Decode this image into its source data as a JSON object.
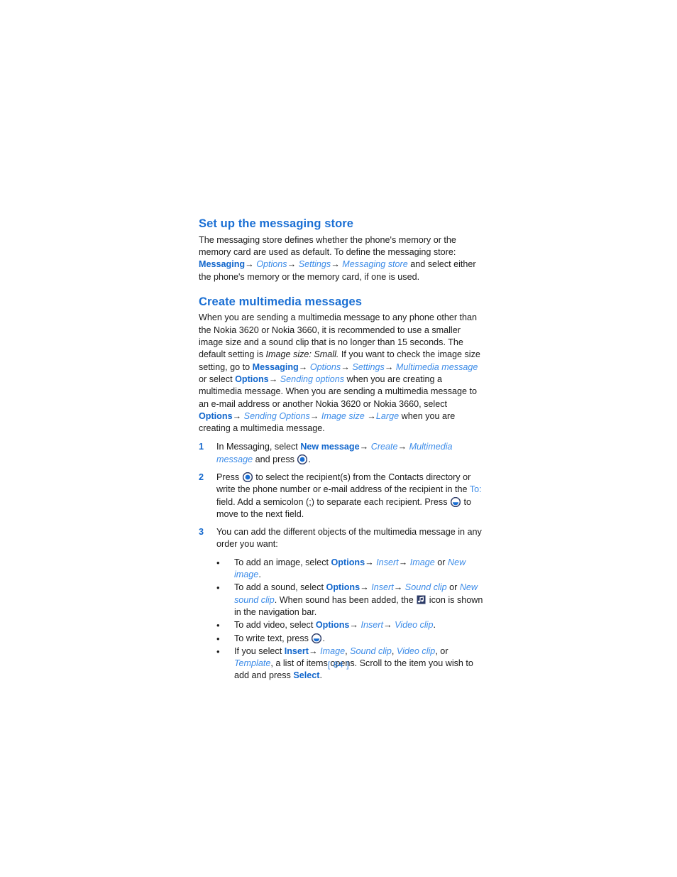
{
  "colors": {
    "heading": "#1a6fd4",
    "command_bold": "#1166cc",
    "menu_italic": "#3d8ce8",
    "body": "#1a1a1a",
    "page_number": "#2f86e8",
    "icon_blue": "#1a6fd4",
    "icon_dark": "#2b3a67"
  },
  "footer": {
    "page_number": "[ 84 ]"
  },
  "sections": [
    {
      "id": "messaging-store",
      "heading": "Set up the messaging store",
      "paragraph1": "The messaging store defines whether the phone's memory or the memory card are used as default. To define the messaging store:",
      "path": {
        "command": "Messaging",
        "arrow1": "→",
        "item1": "Options",
        "arrow2": "→",
        "item2": "Settings",
        "arrow3": "→",
        "item3": "Messaging store",
        "tail": " and select either the phone's memory or the memory card, if one is used."
      }
    },
    {
      "id": "create-multimedia-messages",
      "heading": "Create multimedia messages",
      "intro_part1": "When you are sending a multimedia message to any phone other than the Nokia 3620 or Nokia 3660, it is recommended to use a smaller image size and a sound clip that is no longer than 15 seconds. The default setting is ",
      "intro_emphasis": "Image size: Small.",
      "intro_part2": " If you want to check the image size setting, go to ",
      "path1": {
        "command": "Messaging",
        "arrow1": "→",
        "item1": "Options",
        "arrow2": "→",
        "item2": "Settings",
        "arrow3": "→",
        "item3": "Multimedia message",
        "tail": " or select "
      },
      "path2": {
        "command": "Options",
        "arrow1": "→",
        "item1": "Sending options",
        "tail": " when you are creating a multimedia message. When you are sending a multimedia message to an e-mail address or another Nokia 3620 or Nokia 3660, select "
      },
      "path3": {
        "command": "Options",
        "arrow1": "→",
        "item1": "Sending Options",
        "arrow2": "→",
        "item2": "Image size",
        "arrow3": "→",
        "item3": "Large",
        "tail": " when you are creating a multimedia message."
      }
    }
  ],
  "steps": [
    {
      "number": "1",
      "lead": "In Messaging, select ",
      "command": "New message",
      "arrow1": "→",
      "item1": "Create",
      "arrow2": "→",
      "item2": "Multimedia message",
      "tail_before_icon": " and press ",
      "icon": "joystick-press-icon",
      "tail_after_icon": "."
    },
    {
      "number": "2",
      "lead": "Press ",
      "icon1": "joystick-press-icon",
      "mid1": " to select the recipient(s) from the Contacts directory or write the phone number or e-mail address of the recipient in the ",
      "field_label": "To:",
      "mid2": " field. Add a semicolon (;) to separate each recipient. Press ",
      "icon2": "joystick-scroll-down-icon",
      "tail": " to move to the next field."
    },
    {
      "number": "3",
      "text": "You can add the different objects of the multimedia message in any order you want:"
    }
  ],
  "bullets": [
    {
      "id": "add-image",
      "dot": "•",
      "lead": "To add an image, select ",
      "command": "Options",
      "arrow1": "→",
      "item1": "Insert",
      "arrow2": "→",
      "item2": "Image",
      "conjunction": " or ",
      "item3": "New image",
      "tail": "."
    },
    {
      "id": "add-sound",
      "dot": "•",
      "lead": "To add a sound, select ",
      "command": "Options",
      "arrow1": "→",
      "item1": "Insert",
      "arrow2": "→",
      "item2": "Sound clip",
      "conjunction": " or ",
      "item3": "New sound clip",
      "mid": ". When sound has been added, the ",
      "icon": "music-note-icon",
      "tail": " icon is shown in the navigation bar."
    },
    {
      "id": "add-video",
      "dot": "•",
      "lead": "To add video, select ",
      "command": "Options",
      "arrow1": "→",
      "item1": "Insert",
      "arrow2": "→",
      "item2": "Video clip",
      "tail": "."
    },
    {
      "id": "write-text",
      "dot": "•",
      "lead": "To write text, press ",
      "icon": "joystick-scroll-down-icon",
      "tail": "."
    },
    {
      "id": "insert-list",
      "dot": "•",
      "lead": "If you select ",
      "command": "Insert",
      "arrow1": "→",
      "item1": "Image",
      "sep1": ", ",
      "item2": "Sound clip",
      "sep2": ", ",
      "item3": "Video clip",
      "sep3": ", or ",
      "item4": "Template",
      "mid": ", a list of items opens. Scroll to the item you wish to add and press ",
      "command2": "Select",
      "tail": "."
    }
  ]
}
